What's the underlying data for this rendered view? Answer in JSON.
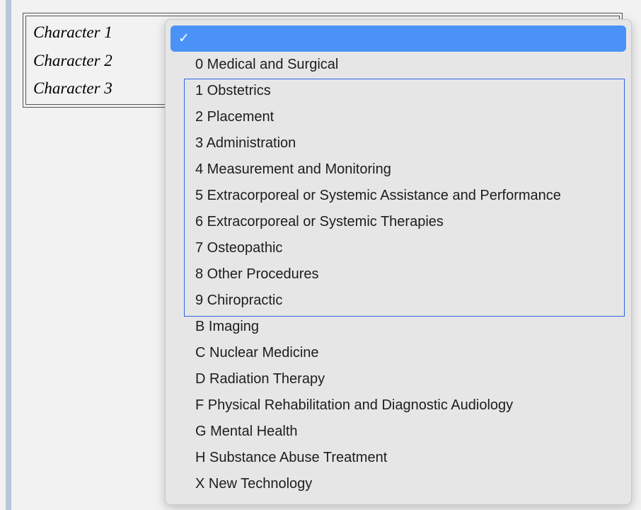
{
  "form": {
    "labels": [
      "Character 1",
      "Character 2",
      "Character 3"
    ]
  },
  "dropdown": {
    "selected_icon": "checkmark-icon",
    "selected_glyph": "✓",
    "options": [
      "0 Medical and Surgical",
      "1 Obstetrics",
      "2 Placement",
      "3 Administration",
      "4 Measurement and Monitoring",
      "5 Extracorporeal or Systemic Assistance and Performance",
      "6 Extracorporeal or Systemic Therapies",
      "7 Osteopathic",
      "8 Other Procedures",
      "9 Chiropractic",
      "B Imaging",
      "C Nuclear Medicine",
      "D Radiation Therapy",
      "F Physical Rehabilitation and Diagnostic Audiology",
      "G Mental Health",
      "H Substance Abuse Treatment",
      "X New Technology"
    ]
  },
  "colors": {
    "selection_highlight": "#4a92f7",
    "focus_outline": "#2f63e6",
    "menu_background": "#e6e6e6",
    "sidebar_stripe": "#b9c6db"
  }
}
